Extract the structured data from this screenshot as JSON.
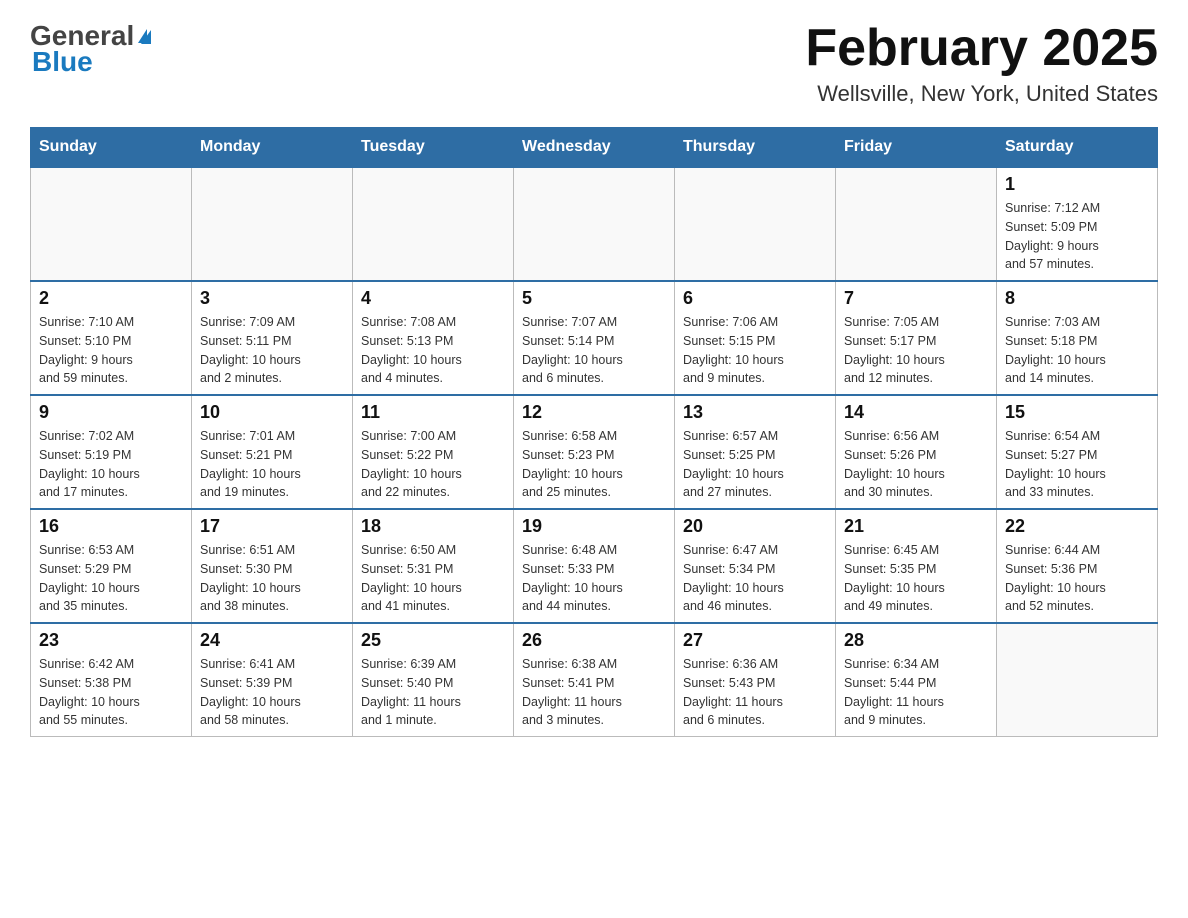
{
  "header": {
    "logo_general": "General",
    "logo_blue": "Blue",
    "title": "February 2025",
    "subtitle": "Wellsville, New York, United States"
  },
  "days_of_week": [
    "Sunday",
    "Monday",
    "Tuesday",
    "Wednesday",
    "Thursday",
    "Friday",
    "Saturday"
  ],
  "weeks": [
    {
      "cells": [
        {
          "day": "",
          "info": ""
        },
        {
          "day": "",
          "info": ""
        },
        {
          "day": "",
          "info": ""
        },
        {
          "day": "",
          "info": ""
        },
        {
          "day": "",
          "info": ""
        },
        {
          "day": "",
          "info": ""
        },
        {
          "day": "1",
          "info": "Sunrise: 7:12 AM\nSunset: 5:09 PM\nDaylight: 9 hours\nand 57 minutes."
        }
      ]
    },
    {
      "cells": [
        {
          "day": "2",
          "info": "Sunrise: 7:10 AM\nSunset: 5:10 PM\nDaylight: 9 hours\nand 59 minutes."
        },
        {
          "day": "3",
          "info": "Sunrise: 7:09 AM\nSunset: 5:11 PM\nDaylight: 10 hours\nand 2 minutes."
        },
        {
          "day": "4",
          "info": "Sunrise: 7:08 AM\nSunset: 5:13 PM\nDaylight: 10 hours\nand 4 minutes."
        },
        {
          "day": "5",
          "info": "Sunrise: 7:07 AM\nSunset: 5:14 PM\nDaylight: 10 hours\nand 6 minutes."
        },
        {
          "day": "6",
          "info": "Sunrise: 7:06 AM\nSunset: 5:15 PM\nDaylight: 10 hours\nand 9 minutes."
        },
        {
          "day": "7",
          "info": "Sunrise: 7:05 AM\nSunset: 5:17 PM\nDaylight: 10 hours\nand 12 minutes."
        },
        {
          "day": "8",
          "info": "Sunrise: 7:03 AM\nSunset: 5:18 PM\nDaylight: 10 hours\nand 14 minutes."
        }
      ]
    },
    {
      "cells": [
        {
          "day": "9",
          "info": "Sunrise: 7:02 AM\nSunset: 5:19 PM\nDaylight: 10 hours\nand 17 minutes."
        },
        {
          "day": "10",
          "info": "Sunrise: 7:01 AM\nSunset: 5:21 PM\nDaylight: 10 hours\nand 19 minutes."
        },
        {
          "day": "11",
          "info": "Sunrise: 7:00 AM\nSunset: 5:22 PM\nDaylight: 10 hours\nand 22 minutes."
        },
        {
          "day": "12",
          "info": "Sunrise: 6:58 AM\nSunset: 5:23 PM\nDaylight: 10 hours\nand 25 minutes."
        },
        {
          "day": "13",
          "info": "Sunrise: 6:57 AM\nSunset: 5:25 PM\nDaylight: 10 hours\nand 27 minutes."
        },
        {
          "day": "14",
          "info": "Sunrise: 6:56 AM\nSunset: 5:26 PM\nDaylight: 10 hours\nand 30 minutes."
        },
        {
          "day": "15",
          "info": "Sunrise: 6:54 AM\nSunset: 5:27 PM\nDaylight: 10 hours\nand 33 minutes."
        }
      ]
    },
    {
      "cells": [
        {
          "day": "16",
          "info": "Sunrise: 6:53 AM\nSunset: 5:29 PM\nDaylight: 10 hours\nand 35 minutes."
        },
        {
          "day": "17",
          "info": "Sunrise: 6:51 AM\nSunset: 5:30 PM\nDaylight: 10 hours\nand 38 minutes."
        },
        {
          "day": "18",
          "info": "Sunrise: 6:50 AM\nSunset: 5:31 PM\nDaylight: 10 hours\nand 41 minutes."
        },
        {
          "day": "19",
          "info": "Sunrise: 6:48 AM\nSunset: 5:33 PM\nDaylight: 10 hours\nand 44 minutes."
        },
        {
          "day": "20",
          "info": "Sunrise: 6:47 AM\nSunset: 5:34 PM\nDaylight: 10 hours\nand 46 minutes."
        },
        {
          "day": "21",
          "info": "Sunrise: 6:45 AM\nSunset: 5:35 PM\nDaylight: 10 hours\nand 49 minutes."
        },
        {
          "day": "22",
          "info": "Sunrise: 6:44 AM\nSunset: 5:36 PM\nDaylight: 10 hours\nand 52 minutes."
        }
      ]
    },
    {
      "cells": [
        {
          "day": "23",
          "info": "Sunrise: 6:42 AM\nSunset: 5:38 PM\nDaylight: 10 hours\nand 55 minutes."
        },
        {
          "day": "24",
          "info": "Sunrise: 6:41 AM\nSunset: 5:39 PM\nDaylight: 10 hours\nand 58 minutes."
        },
        {
          "day": "25",
          "info": "Sunrise: 6:39 AM\nSunset: 5:40 PM\nDaylight: 11 hours\nand 1 minute."
        },
        {
          "day": "26",
          "info": "Sunrise: 6:38 AM\nSunset: 5:41 PM\nDaylight: 11 hours\nand 3 minutes."
        },
        {
          "day": "27",
          "info": "Sunrise: 6:36 AM\nSunset: 5:43 PM\nDaylight: 11 hours\nand 6 minutes."
        },
        {
          "day": "28",
          "info": "Sunrise: 6:34 AM\nSunset: 5:44 PM\nDaylight: 11 hours\nand 9 minutes."
        },
        {
          "day": "",
          "info": ""
        }
      ]
    }
  ]
}
